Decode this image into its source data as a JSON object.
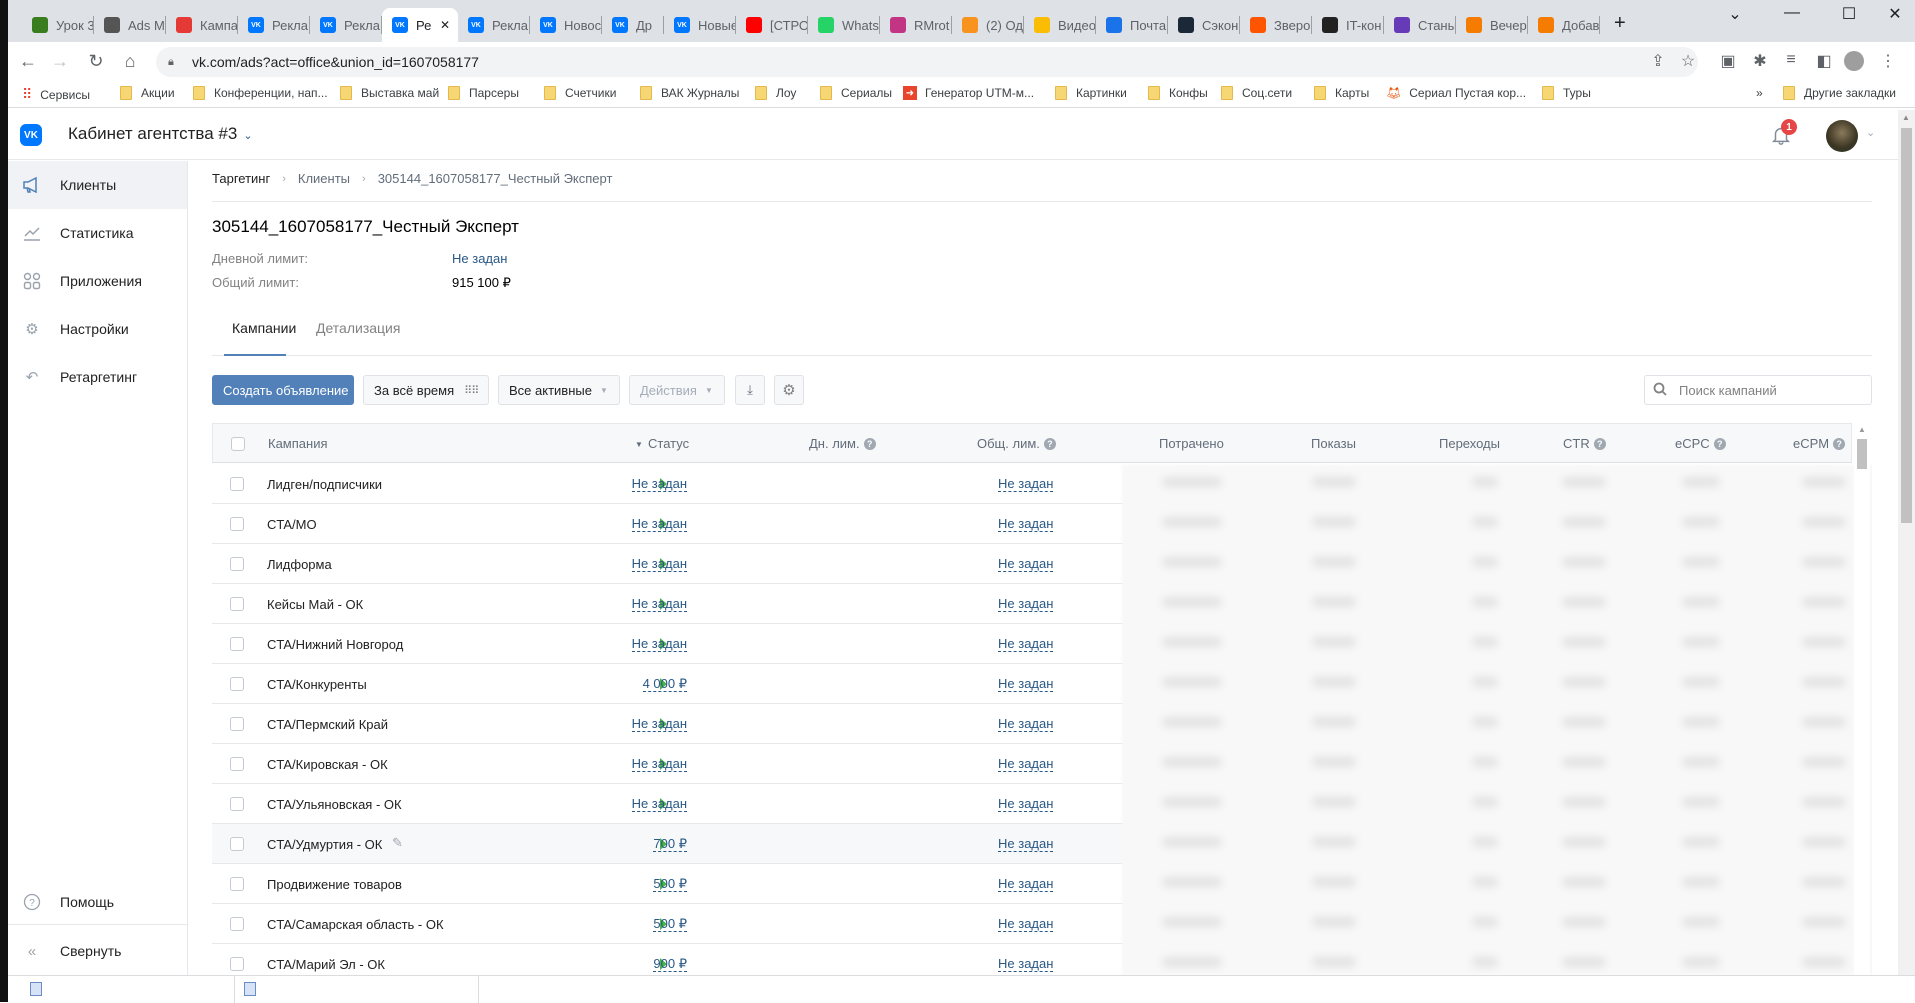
{
  "browser": {
    "tabs": [
      {
        "label": "Урок 3",
        "icon": "green-square-icon",
        "color": "#3a7d1e"
      },
      {
        "label": "Ads M",
        "icon": "ads-manager-icon",
        "color": "#555"
      },
      {
        "label": "Кампа",
        "icon": "target-icon",
        "color": "#e53935"
      },
      {
        "label": "Рекла",
        "icon": "vk-icon",
        "color": "#0077ff"
      },
      {
        "label": "Рекла",
        "icon": "vk-icon",
        "color": "#0077ff"
      },
      {
        "label": "Ре",
        "icon": "vk-icon",
        "color": "#0077ff",
        "active": true
      },
      {
        "label": "Рекла",
        "icon": "vk-icon",
        "color": "#0077ff"
      },
      {
        "label": "Новос",
        "icon": "vk-icon",
        "color": "#0077ff"
      },
      {
        "label": "Др",
        "icon": "vk-heart-icon",
        "color": "#0077ff"
      },
      {
        "label": "Новые",
        "icon": "vk-icon",
        "color": "#0077ff"
      },
      {
        "label": "[СТРО",
        "icon": "youtube-icon",
        "color": "#ff0000"
      },
      {
        "label": "Whats",
        "icon": "whatsapp-icon",
        "color": "#25d366"
      },
      {
        "label": "RMrot",
        "icon": "instagram-icon",
        "color": "#c13584"
      },
      {
        "label": "(2) Од",
        "icon": "odnoklassniki-icon",
        "color": "#f7931e"
      },
      {
        "label": "Видео",
        "icon": "google-ads-icon",
        "color": "#fbbc04"
      },
      {
        "label": "Почта",
        "icon": "mail-icon",
        "color": "#1a73e8"
      },
      {
        "label": "Сэкон",
        "icon": "steam-icon",
        "color": "#1b2838"
      },
      {
        "label": "Зверо",
        "icon": "kinopoisk-icon",
        "color": "#ff5500"
      },
      {
        "label": "IT-кон",
        "icon": "glasses-icon",
        "color": "#222"
      },
      {
        "label": "Станы",
        "icon": "forms-icon",
        "color": "#673ab7"
      },
      {
        "label": "Вечер",
        "icon": "ball-icon",
        "color": "#f57c00"
      },
      {
        "label": "Добав",
        "icon": "ball-icon",
        "color": "#f57c00"
      }
    ],
    "new_tab": "+",
    "url": "vk.com/ads?act=office&union_id=1607058177",
    "bookmarks": [
      {
        "label": "Сервисы",
        "icon": "apps-icon"
      },
      {
        "label": "Акции",
        "icon": "folder-icon"
      },
      {
        "label": "Конференции, нап...",
        "icon": "folder-icon"
      },
      {
        "label": "Выставка май",
        "icon": "folder-icon"
      },
      {
        "label": "Парсеры",
        "icon": "folder-icon"
      },
      {
        "label": "Счетчики",
        "icon": "folder-icon"
      },
      {
        "label": "ВАК Журналы",
        "icon": "folder-icon"
      },
      {
        "label": "Лоу",
        "icon": "folder-icon"
      },
      {
        "label": "Сериалы",
        "icon": "folder-icon"
      },
      {
        "label": "Генератор UTM-м...",
        "icon": "utm-icon"
      },
      {
        "label": "Картинки",
        "icon": "folder-icon"
      },
      {
        "label": "Конфы",
        "icon": "folder-icon"
      },
      {
        "label": "Соц.сети",
        "icon": "folder-icon"
      },
      {
        "label": "Карты",
        "icon": "folder-icon"
      },
      {
        "label": "Сериал Пустая кор...",
        "icon": "fox-icon"
      },
      {
        "label": "Туры",
        "icon": "folder-icon"
      }
    ],
    "bookmarks_overflow": "»",
    "other_bookmarks": "Другие закладки"
  },
  "header": {
    "cabinet": "Кабинет агентства #3",
    "notifications": "1"
  },
  "sidebar": {
    "items": [
      {
        "label": "Клиенты",
        "icon": "megaphone-icon",
        "active": true
      },
      {
        "label": "Статистика",
        "icon": "chart-icon"
      },
      {
        "label": "Приложения",
        "icon": "apps-grid-icon"
      },
      {
        "label": "Настройки",
        "icon": "gear-icon"
      },
      {
        "label": "Ретаргетинг",
        "icon": "retarget-icon"
      }
    ],
    "help": "Помощь",
    "collapse": "Свернуть"
  },
  "breadcrumbs": [
    "Таргетинг",
    "Клиенты",
    "305144_1607058177_Честный Эксперт"
  ],
  "client": {
    "title": "305144_1607058177_Честный Эксперт",
    "daily_limit_label": "Дневной лимит:",
    "daily_limit_value": "Не задан",
    "total_limit_label": "Общий лимит:",
    "total_limit_value": "915 100 ₽"
  },
  "tabs": [
    "Кампании",
    "Детализация"
  ],
  "toolbar": {
    "create": "Создать объявление",
    "period": "За всё время",
    "filter": "Все активные",
    "actions": "Действия",
    "search_placeholder": "Поиск кампаний"
  },
  "table": {
    "columns": [
      "Кампания",
      "Статус",
      "Дн. лим.",
      "Общ. лим.",
      "Потрачено",
      "Показы",
      "Переходы",
      "CTR",
      "eCPC",
      "eCPM"
    ],
    "rows": [
      {
        "name": "Лидген/подписчики",
        "status": "running",
        "daily": "Не задан",
        "total": "Не задан"
      },
      {
        "name": "CTA/МО",
        "status": "running",
        "daily": "Не задан",
        "total": "Не задан"
      },
      {
        "name": "Лидформа",
        "status": "running",
        "daily": "Не задан",
        "total": "Не задан"
      },
      {
        "name": "Кейсы Май - ОК",
        "status": "running",
        "daily": "Не задан",
        "total": "Не задан"
      },
      {
        "name": "CTA/Нижний Новгород",
        "status": "running",
        "daily": "Не задан",
        "total": "Не задан"
      },
      {
        "name": "CTA/Конкуренты",
        "status": "running",
        "daily": "4 000 ₽",
        "total": "Не задан"
      },
      {
        "name": "CTA/Пермский Край",
        "status": "running",
        "daily": "Не задан",
        "total": "Не задан"
      },
      {
        "name": "CTA/Кировская - ОК",
        "status": "running",
        "daily": "Не задан",
        "total": "Не задан"
      },
      {
        "name": "CTA/Ульяновская - ОК",
        "status": "running",
        "daily": "Не задан",
        "total": "Не задан"
      },
      {
        "name": "CTA/Удмуртия - ОК",
        "status": "running",
        "daily": "700 ₽",
        "total": "Не задан",
        "hovered": true
      },
      {
        "name": "Продвижение товаров",
        "status": "running",
        "daily": "500 ₽",
        "total": "Не задан"
      },
      {
        "name": "CTA/Самарская область - ОК",
        "status": "running",
        "daily": "500 ₽",
        "total": "Не задан"
      },
      {
        "name": "CTA/Марий Эл - ОК",
        "status": "running",
        "daily": "900 ₽",
        "total": "Не задан"
      }
    ]
  },
  "colors": {
    "accent": "#5181b8",
    "link": "#2a5885",
    "status_running": "#4bb34b",
    "badge": "#e64646"
  }
}
